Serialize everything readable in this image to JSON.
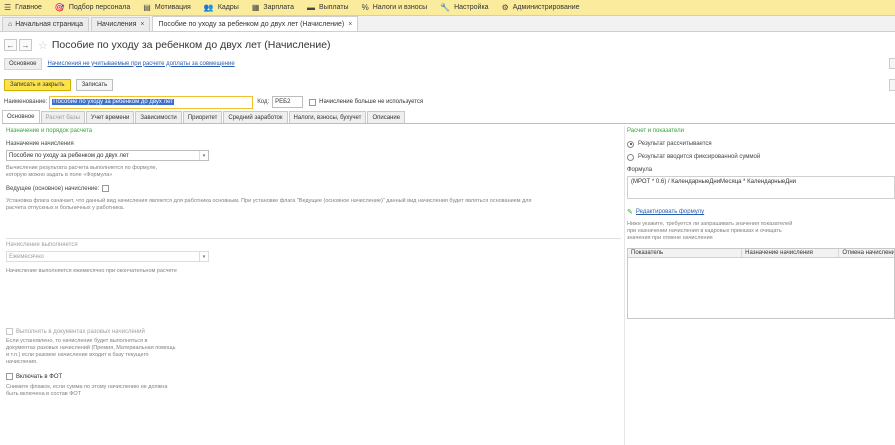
{
  "menu": [
    {
      "icon": "☰",
      "label": "Главное"
    },
    {
      "icon": "🎯",
      "label": "Подбор персонала"
    },
    {
      "icon": "▤",
      "label": "Мотивация"
    },
    {
      "icon": "👥",
      "label": "Кадры"
    },
    {
      "icon": "▦",
      "label": "Зарплата"
    },
    {
      "icon": "▬",
      "label": "Выплаты"
    },
    {
      "icon": "%",
      "label": "Налоги и взносы"
    },
    {
      "icon": "🔧",
      "label": "Настройка"
    },
    {
      "icon": "⚙",
      "label": "Администрирование"
    }
  ],
  "open_tabs": {
    "home": "Начальная страница",
    "items": [
      {
        "label": "Начисления"
      },
      {
        "label": "Пособие по уходу за ребенком до двух лет (Начисление)"
      }
    ],
    "close_glyph": "×"
  },
  "window": {
    "title": "Пособие по уходу за ребенком до двух лет (Начисление)",
    "back": "←",
    "forward": "→",
    "star": "☆"
  },
  "sections": {
    "main": "Основное",
    "link": "Начисления не учитываемые при расчете доплаты за совмещение"
  },
  "toolbar": {
    "save_close": "Записать и закрыть",
    "save": "Записать"
  },
  "name_row": {
    "name_label": "Наименование:",
    "name_value": "Пособие по уходу за ребенком до двух лет",
    "code_label": "Код:",
    "code_value": "РЕБ2",
    "unused_label": "Начисление больше не используется"
  },
  "tabs": [
    {
      "label": "Основное",
      "state": "active"
    },
    {
      "label": "Расчет базы",
      "state": "disabled"
    },
    {
      "label": "Учет времени",
      "state": "normal"
    },
    {
      "label": "Зависимости",
      "state": "normal"
    },
    {
      "label": "Приоритет",
      "state": "normal"
    },
    {
      "label": "Средний заработок",
      "state": "normal"
    },
    {
      "label": "Налоги, взносы, бухучет",
      "state": "normal"
    },
    {
      "label": "Описание",
      "state": "normal"
    }
  ],
  "left": {
    "group_title": "Назначение и порядок расчета",
    "purpose_label": "Назначение начисления",
    "purpose_value": "Пособие по уходу за ребенком до двух лет",
    "hint_calc_1": "Вычисление результата расчета выполняется по формуле,",
    "hint_calc_2": "которую можно задать в поле «Формула»",
    "leading_label": "Ведущее (основное) начисление:",
    "leading_hint_1": "Установка флага означает, что данный вид начисления является для работника основным. При установке флага \"Ведущее (основное начисление)\" данный вид начисления будет являться основанием для",
    "leading_hint_2": "расчета отпускных и больничных у работника.",
    "performed_label": "Начисление выполняется",
    "performed_value": "Ежемесячно",
    "performed_hint": "Начисление выполняется ежемесячно при окончательном расчете",
    "onetime_label": "Выполнять в документах разовых начислений",
    "onetime_hint_1": "Если установлено, то начисление будет выполняться в",
    "onetime_hint_2": "документах разовых начислений (Премия, Материальная помощь",
    "onetime_hint_3": "и т.п.) если разовое начисление входит в базу текущего",
    "onetime_hint_4": "начисления.",
    "fot_label": "Включать в ФОТ",
    "fot_hint_1": "Снимите флажок, если сумма по этому начислению не должна",
    "fot_hint_2": "быть включена в состав ФОТ"
  },
  "right": {
    "group_title": "Расчет и показатели",
    "radio_calc": "Результат рассчитывается",
    "radio_fixed": "Результат вводится фиксированной суммой",
    "formula_label": "Формула",
    "formula_value": "(МРОТ * 0.6) /  КалендарныеДниМесяца * КалендарныеДни",
    "edit_formula": "Редактировать формулу",
    "note_1": "Ниже укажите, требуется ли запрашивать значения показателей",
    "note_2": "при назначении начисления в кадровых приказах и очищать",
    "note_3": "значения при отмене начисления",
    "grid_cols": [
      "Показатель",
      "Назначение начисления",
      "Отмена начисления"
    ]
  },
  "colors": {
    "menubar": "#fbeb9c",
    "primary_button": "#fce24d",
    "group_title": "#3aa23a",
    "link": "#2a5db0",
    "selection": "#3b6fcf"
  }
}
